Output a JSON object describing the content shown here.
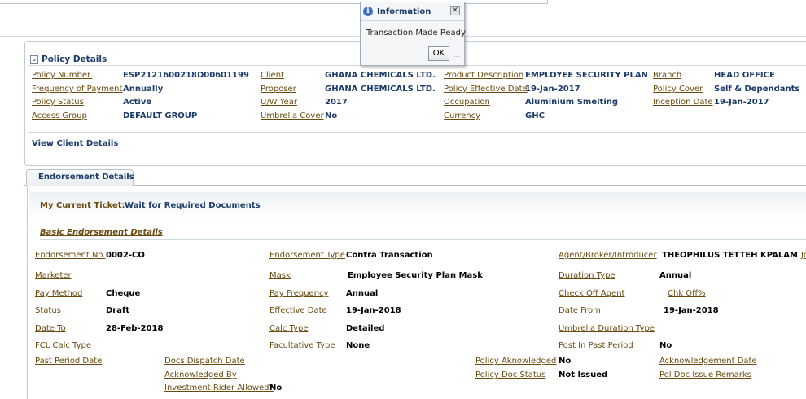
{
  "dialog": {
    "title": "Information",
    "message": "Transaction Made Ready",
    "ok_label": "OK"
  },
  "policy": {
    "section_title": "Policy Details",
    "fields": [
      {
        "label": "Policy Number.",
        "value": "ESP2121600218D00601199"
      },
      {
        "label": "Frequency of Payment",
        "value": "Annually"
      },
      {
        "label": "Policy Status",
        "value": "Active"
      },
      {
        "label": "Access Group",
        "value": "DEFAULT GROUP"
      },
      {
        "label": "Client",
        "value": "GHANA CHEMICALS LTD."
      },
      {
        "label": "Proposer",
        "value": "GHANA CHEMICALS LTD."
      },
      {
        "label": "U/W Year",
        "value": "2017"
      },
      {
        "label": "Umbrella Cover",
        "value": "No"
      },
      {
        "label": "Product Description",
        "value": "EMPLOYEE SECURITY PLAN"
      },
      {
        "label": "Policy Effective Date",
        "value": "19-Jan-2017"
      },
      {
        "label": "Occupation",
        "value": "Aluminium Smelting"
      },
      {
        "label": "Currency",
        "value": "GHC"
      },
      {
        "label": "Branch",
        "value": "HEAD OFFICE"
      },
      {
        "label": "Policy Cover",
        "value": "Self & Dependants"
      },
      {
        "label": "Inception Date",
        "value": "19-Jan-2017"
      }
    ],
    "view_client": "View Client Details"
  },
  "endorsement": {
    "tab_label": "Endorsement Details",
    "ticket_label": "My Current Ticket:",
    "ticket_value": "Wait for Required Documents",
    "basic_title": "Basic Endorsement Details",
    "fields": [
      {
        "label": "Endorsement No.",
        "value": "0002-CO"
      },
      {
        "label": "Marketer",
        "value": ""
      },
      {
        "label": "Pay Method",
        "value": "Cheque"
      },
      {
        "label": "Status",
        "value": "Draft"
      },
      {
        "label": "Date To",
        "value": "28-Feb-2018"
      },
      {
        "label": "FCL Calc Type",
        "value": ""
      },
      {
        "label": "Past Period Date",
        "value": ""
      },
      {
        "label": "Endorsement Type",
        "value": "Contra Transaction"
      },
      {
        "label": "Mask",
        "value": "Employee Security Plan Mask"
      },
      {
        "label": "Pay Frequency",
        "value": "Annual"
      },
      {
        "label": "Effective Date",
        "value": "19-Jan-2018"
      },
      {
        "label": "Calc Type",
        "value": "Detailed"
      },
      {
        "label": "Facultative Type",
        "value": "None"
      },
      {
        "label": "Agent/Broker/Introducer",
        "value": "THEOPHILUS TETTEH KPALAM"
      },
      {
        "label": "Duration Type",
        "value": "Annual"
      },
      {
        "label": "Check Off Agent",
        "value": ""
      },
      {
        "label": "Date From",
        "value": "19-Jan-2018"
      },
      {
        "label": "Umbrella Duration Type",
        "value": ""
      },
      {
        "label": "Post In Past Period",
        "value": "No"
      },
      {
        "label": "Docs Dispatch Date",
        "value": ""
      },
      {
        "label": "Acknowledged By",
        "value": ""
      },
      {
        "label": "Investment Rider Allowed?",
        "value": "No"
      },
      {
        "label": "Policy Aknowledged",
        "value": "No"
      },
      {
        "label": "Policy Doc Status",
        "value": "Not Issued"
      },
      {
        "label": "Acknowledgement Date",
        "value": ""
      },
      {
        "label": "Pol Doc Issue Remarks",
        "value": ""
      }
    ],
    "chk_off_link": "Chk Off%",
    "cut_link": "Jo"
  }
}
